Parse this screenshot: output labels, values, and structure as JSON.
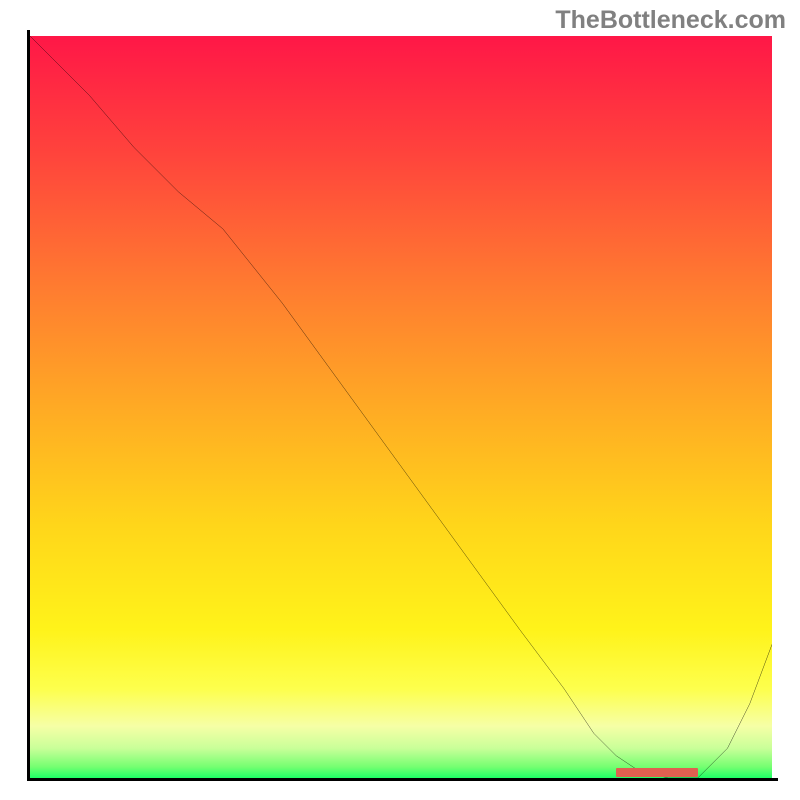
{
  "watermark": "TheBottleneck.com",
  "chart_data": {
    "type": "line",
    "title": "",
    "xlabel": "",
    "ylabel": "",
    "xlim": [
      0,
      100
    ],
    "ylim": [
      0,
      100
    ],
    "x": [
      0,
      3,
      8,
      14,
      20,
      26,
      34,
      42,
      50,
      58,
      66,
      72,
      76,
      79,
      82,
      86,
      90,
      94,
      97,
      100
    ],
    "y": [
      100,
      97,
      92,
      85,
      79,
      74,
      64,
      53,
      42,
      31,
      20,
      12,
      6,
      3,
      1,
      0,
      0,
      4,
      10,
      18
    ],
    "marker": {
      "x_start": 79,
      "x_end": 90,
      "y": 0
    },
    "colors": {
      "curve": "#000000",
      "marker": "#e06050"
    }
  }
}
